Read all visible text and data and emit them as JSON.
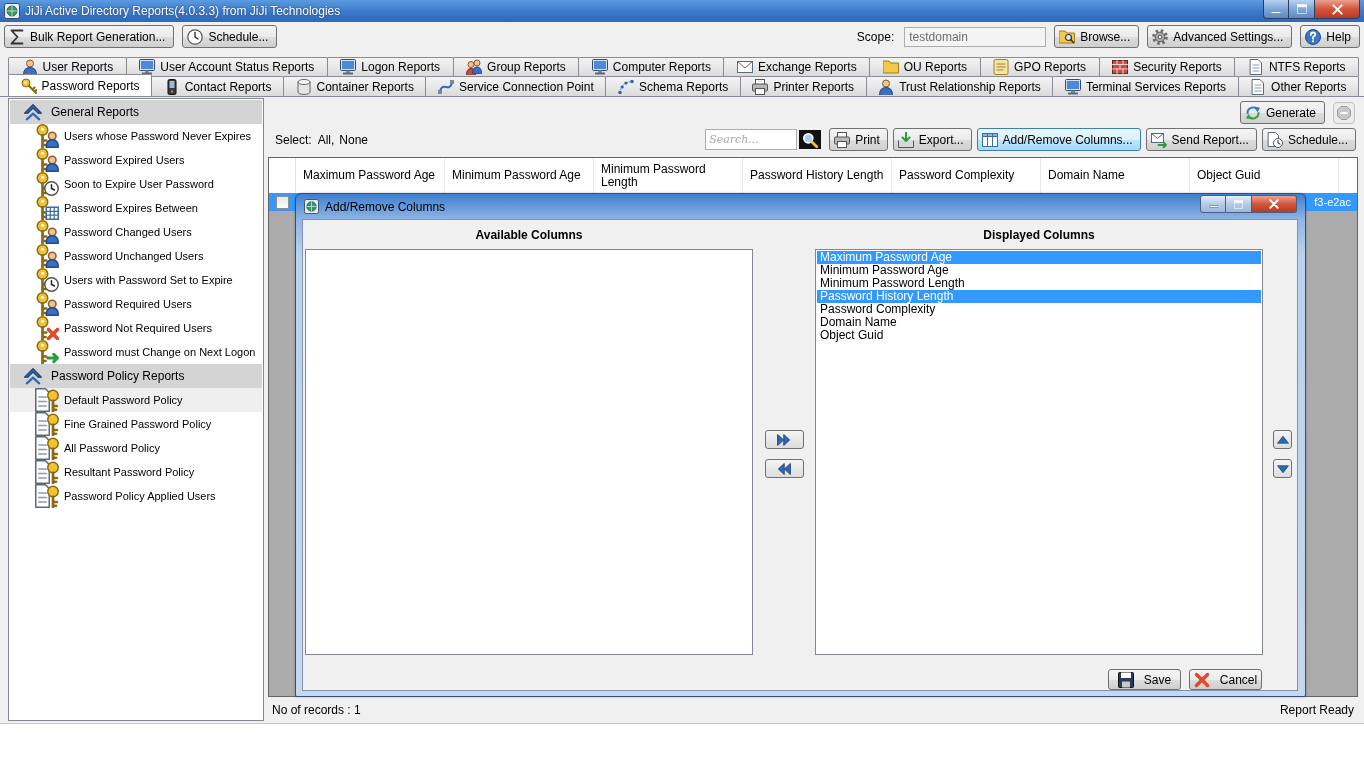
{
  "window": {
    "title": "JiJi Active Directory Reports(4.0.3.3) from JiJi Technologies"
  },
  "toolbar": {
    "left_buttons": [
      "Bulk Report Generation...",
      "Schedule..."
    ],
    "scope": {
      "label": "Scope:",
      "value": "testdomain",
      "disabled": true
    },
    "right_buttons": [
      "Browse...",
      "Advanced Settings...",
      "Help"
    ]
  },
  "tabs": {
    "back_row": [
      {
        "label": "User Reports",
        "selected": false
      },
      {
        "label": "User Account Status Reports",
        "selected": false
      },
      {
        "label": "Logon Reports",
        "selected": false
      },
      {
        "label": "Group Reports",
        "selected": false
      },
      {
        "label": "Computer Reports",
        "selected": false
      },
      {
        "label": "Exchange Reports",
        "selected": false
      },
      {
        "label": "OU Reports",
        "selected": false
      },
      {
        "label": "GPO Reports",
        "selected": false
      },
      {
        "label": "Security Reports",
        "selected": false
      },
      {
        "label": "NTFS Reports",
        "selected": false
      }
    ],
    "front_row": [
      {
        "label": "Password Reports",
        "selected": true
      },
      {
        "label": "Contact Reports",
        "selected": false
      },
      {
        "label": "Container Reports",
        "selected": false
      },
      {
        "label": "Service Connection Point",
        "selected": false
      },
      {
        "label": "Schema Reports",
        "selected": false
      },
      {
        "label": "Printer Reports",
        "selected": false
      },
      {
        "label": "Trust Relationship Reports",
        "selected": false
      },
      {
        "label": "Terminal Services Reports",
        "selected": false
      },
      {
        "label": "Other Reports",
        "selected": false
      }
    ]
  },
  "sidebar": {
    "groups": [
      {
        "title": "General Reports",
        "expanded": true,
        "items": [
          {
            "label": "Users whose Password Never Expires",
            "selected": false
          },
          {
            "label": "Password Expired Users",
            "selected": false
          },
          {
            "label": "Soon to Expire User Password",
            "selected": false
          },
          {
            "label": "Password Expires Between",
            "selected": false
          },
          {
            "label": "Password Changed Users",
            "selected": false
          },
          {
            "label": "Password Unchanged Users",
            "selected": false
          },
          {
            "label": "Users with Password Set to Expire",
            "selected": false
          },
          {
            "label": "Password Required Users",
            "selected": false
          },
          {
            "label": "Password Not Required Users",
            "selected": false
          },
          {
            "label": "Password must Change on Next Logon",
            "selected": false
          }
        ]
      },
      {
        "title": "Password Policy Reports",
        "expanded": true,
        "items": [
          {
            "label": "Default Password Policy",
            "selected": true
          },
          {
            "label": "Fine Grained Password Policy",
            "selected": false
          },
          {
            "label": "All Password Policy",
            "selected": false
          },
          {
            "label": "Resultant Password Policy",
            "selected": false
          },
          {
            "label": "Password Policy Applied Users",
            "selected": false
          }
        ]
      }
    ]
  },
  "report": {
    "generate_button": "Generate",
    "stop_button": {
      "disabled": true
    },
    "select": {
      "label": "Select:",
      "links": [
        "All,",
        "None"
      ]
    },
    "search": {
      "placeholder": "Search..."
    },
    "actions": [
      {
        "label": "Print",
        "focused": false
      },
      {
        "label": "Export...",
        "focused": false
      },
      {
        "label": "Add/Remove Columns...",
        "focused": true
      },
      {
        "label": "Send Report...",
        "focused": false
      },
      {
        "label": "Schedule...",
        "focused": false
      }
    ],
    "grid": {
      "columns": [
        "Maximum Password Age",
        "Minimum Password Age",
        "Minimum Password Length",
        "Password History Length",
        "Password Complexity",
        "Domain Name",
        "Object Guid"
      ],
      "rows": [
        {
          "selected": true,
          "checked": false,
          "object_guid": "f3-e2ac"
        }
      ]
    }
  },
  "dialog": {
    "title": "Add/Remove Columns",
    "available": {
      "heading": "Available Columns"
    },
    "displayed": {
      "heading": "Displayed Columns",
      "items": [
        {
          "label": "Maximum Password Age",
          "selected": true
        },
        {
          "label": "Minimum Password Age",
          "selected": false
        },
        {
          "label": "Minimum Password Length",
          "selected": false
        },
        {
          "label": "Password History Length",
          "selected": true
        },
        {
          "label": "Password Complexity",
          "selected": false
        },
        {
          "label": "Domain Name",
          "selected": false
        },
        {
          "label": "Object Guid",
          "selected": false
        }
      ]
    },
    "buttons": [
      {
        "kind": "save",
        "label": "Save"
      },
      {
        "kind": "cancel",
        "label": "Cancel"
      }
    ]
  },
  "status_bar": {
    "records": "No of records : 1",
    "status": "Report Ready"
  }
}
